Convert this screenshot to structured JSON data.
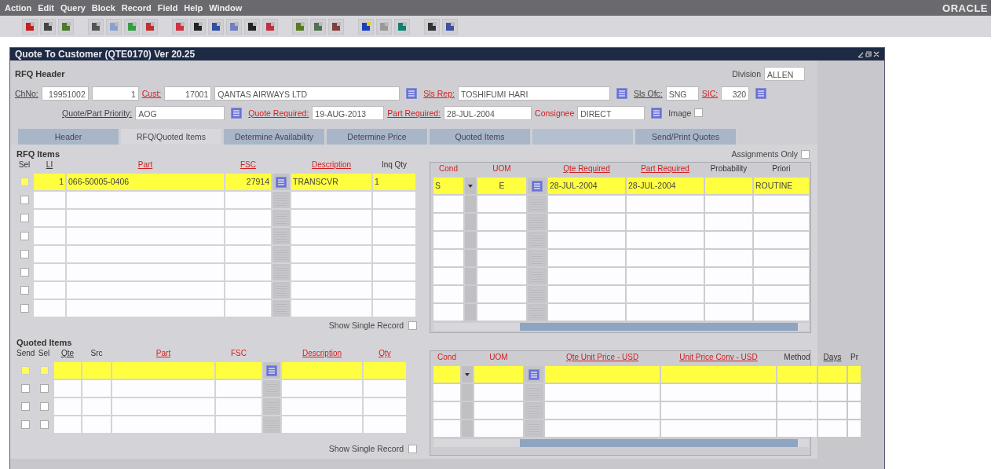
{
  "menu": [
    "Action",
    "Edit",
    "Query",
    "Block",
    "Record",
    "Field",
    "Help",
    "Window"
  ],
  "brand": "ORACLE",
  "window": {
    "title": "Quote To Customer (QTE0170) Ver 20.25"
  },
  "header": {
    "title": "RFQ Header",
    "division_label": "Division",
    "division": "ALLEN",
    "lines": [
      [
        {
          "kind": "label",
          "text": "ChNo:",
          "link": true,
          "required": false
        },
        {
          "kind": "field",
          "value": "19951002"
        },
        {
          "kind": "field",
          "value": "1"
        },
        {
          "kind": "label",
          "text": "Cust:",
          "link": true,
          "required": true
        },
        {
          "kind": "field",
          "value": "17001"
        },
        {
          "kind": "field",
          "value": "QANTAS AIRWAYS LTD"
        },
        {
          "kind": "lov"
        },
        {
          "kind": "label",
          "text": "Sls Rep:",
          "link": true,
          "required": true
        },
        {
          "kind": "field",
          "value": "TOSHIFUMI HARI"
        },
        {
          "kind": "lov"
        },
        {
          "kind": "label",
          "text": "Sls Ofc:",
          "link": true,
          "required": false
        },
        {
          "kind": "field",
          "value": "SNG"
        },
        {
          "kind": "label",
          "text": "SIC:",
          "link": true,
          "required": true
        },
        {
          "kind": "field",
          "value": "320"
        },
        {
          "kind": "lov"
        }
      ],
      [
        {
          "kind": "label",
          "text": "Quote/Part Priority:",
          "link": true,
          "required": false
        },
        {
          "kind": "field",
          "value": "AOG"
        },
        {
          "kind": "lov"
        },
        {
          "kind": "label",
          "text": "Quote Required:",
          "link": true,
          "required": true
        },
        {
          "kind": "field",
          "value": "19-AUG-2013"
        },
        {
          "kind": "label",
          "text": "Part Required:",
          "link": true,
          "required": true
        },
        {
          "kind": "field",
          "value": "28-JUL-2004"
        },
        {
          "kind": "label",
          "text": "Consignee",
          "link": false,
          "required": true
        },
        {
          "kind": "field",
          "value": "DIRECT"
        },
        {
          "kind": "lov"
        },
        {
          "kind": "label",
          "text": "Image",
          "link": false,
          "required": false
        },
        {
          "kind": "checkbox",
          "checked": false
        }
      ]
    ]
  },
  "tabs": [
    {
      "label": "Header",
      "selected": false,
      "disabled": false
    },
    {
      "label": "RFQ/Quoted Items",
      "selected": true,
      "disabled": false
    },
    {
      "label": "Determine Availability",
      "selected": false,
      "disabled": false
    },
    {
      "label": "Determine Price",
      "selected": false,
      "disabled": false
    },
    {
      "label": "Quoted Items",
      "selected": false,
      "disabled": false
    },
    {
      "selected": false,
      "disabled": true
    },
    {
      "label": "Send/Print Quotes",
      "selected": false,
      "disabled": false
    }
  ],
  "rfq_items": {
    "title": "RFQ Items",
    "assignments_label": "Assignments Only",
    "assignments_only": false,
    "show_single_label": "Show Single Record",
    "show_single": false,
    "left_columns": [
      {
        "label": "Sel",
        "kind": "checkbox",
        "required": false,
        "link": false
      },
      {
        "label": "LI",
        "kind": "text",
        "required": false,
        "link": true
      },
      {
        "label": "Part",
        "kind": "text",
        "required": true,
        "link": true
      },
      {
        "label": "FSC",
        "kind": "text",
        "required": true,
        "link": true
      },
      {
        "kind": "lov"
      },
      {
        "label": "Description",
        "kind": "text",
        "required": true,
        "link": true
      },
      {
        "label": "Inq Qty",
        "kind": "text",
        "required": false,
        "link": false
      }
    ],
    "right_columns": [
      {
        "label": "Cond",
        "kind": "text",
        "required": true,
        "link": false
      },
      {
        "kind": "dropdown"
      },
      {
        "label": "UOM",
        "kind": "text",
        "required": true,
        "link": false
      },
      {
        "kind": "lov"
      },
      {
        "label": "Qte Required",
        "kind": "text",
        "required": true,
        "link": true
      },
      {
        "label": "Part Required",
        "kind": "text",
        "required": true,
        "link": true
      },
      {
        "label": "Probability",
        "kind": "text",
        "required": false,
        "link": false
      },
      {
        "label": "Priori",
        "kind": "text",
        "required": false,
        "link": false
      }
    ],
    "rows": [
      {
        "current": true,
        "checked": false,
        "left": {
          "li": "1",
          "part": "066-50005-0406",
          "fsc": "27914",
          "description": "TRANSCVR",
          "inq_qty": "1"
        },
        "right": {
          "cond": "S",
          "uom": "E",
          "qte_required": "28-JUL-2004",
          "part_required": "28-JUL-2004",
          "priori": "ROUTINE"
        }
      },
      {
        "current": false,
        "checked": false
      },
      {
        "current": false,
        "checked": false
      },
      {
        "current": false,
        "checked": false
      },
      {
        "current": false,
        "checked": false
      },
      {
        "current": false,
        "checked": false
      },
      {
        "current": false,
        "checked": false
      },
      {
        "current": false,
        "checked": false
      }
    ]
  },
  "quoted_items": {
    "title": "Quoted Items",
    "show_single_label": "Show Single Record",
    "show_single": false,
    "left_columns": [
      {
        "label": "Send",
        "kind": "checkbox",
        "required": false,
        "link": false
      },
      {
        "label": "Sel",
        "kind": "checkbox",
        "required": false,
        "link": false
      },
      {
        "label": "Qte",
        "kind": "text",
        "required": false,
        "link": true
      },
      {
        "label": "Src",
        "kind": "text",
        "required": false,
        "link": false
      },
      {
        "label": "Part",
        "kind": "text",
        "required": true,
        "link": true
      },
      {
        "label": "FSC",
        "kind": "text",
        "required": true,
        "link": false
      },
      {
        "kind": "lov"
      },
      {
        "label": "Description",
        "kind": "text",
        "required": true,
        "link": true
      },
      {
        "label": "Qty",
        "kind": "text",
        "required": true,
        "link": true
      }
    ],
    "right_columns": [
      {
        "label": "Cond",
        "kind": "text",
        "required": true,
        "link": false
      },
      {
        "kind": "dropdown"
      },
      {
        "label": "UOM",
        "kind": "text",
        "required": true,
        "link": false
      },
      {
        "kind": "lov"
      },
      {
        "label": "Qte Unit Price - USD",
        "kind": "text",
        "required": true,
        "link": true
      },
      {
        "label": "Unit Price Conv - USD",
        "kind": "text",
        "required": true,
        "link": true
      },
      {
        "label": "Method",
        "kind": "text",
        "required": false,
        "link": false
      },
      {
        "label": "Days",
        "kind": "text",
        "required": false,
        "link": true
      },
      {
        "label": "Pr",
        "kind": "text",
        "required": false,
        "link": false
      }
    ],
    "rows": [
      {
        "current": true,
        "checked": false
      },
      {
        "current": false,
        "checked": false
      },
      {
        "current": false,
        "checked": false
      },
      {
        "current": false,
        "checked": false
      }
    ]
  }
}
